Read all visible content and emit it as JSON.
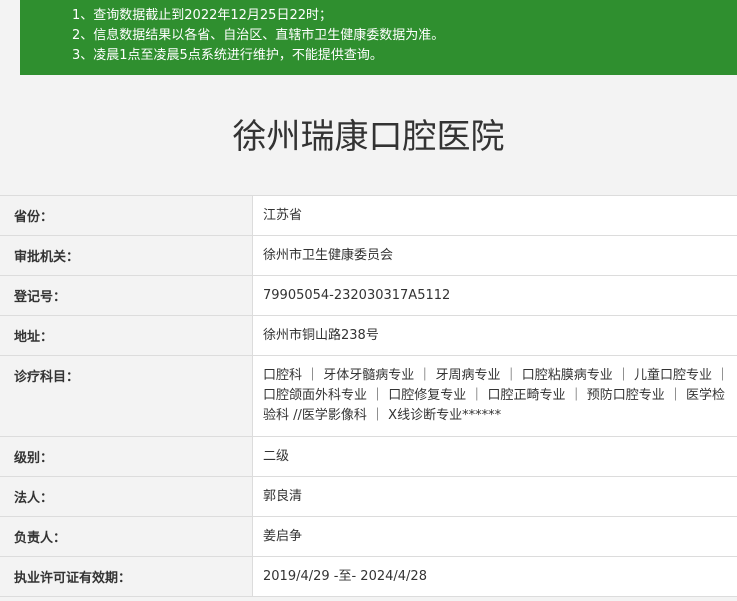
{
  "notice": {
    "lines": [
      "1、查询数据截止到2022年12月25日22时；",
      "2、信息数据结果以各省、自治区、直辖市卫生健康委数据为准。",
      "3、凌晨1点至凌晨5点系统进行维护，不能提供查询。"
    ]
  },
  "hospital": {
    "name": "徐州瑞康口腔医院"
  },
  "rows": [
    {
      "label": "省份：",
      "value": "江苏省"
    },
    {
      "label": "审批机关：",
      "value": "徐州市卫生健康委员会"
    },
    {
      "label": "登记号：",
      "value": "79905054-232030317A5112"
    },
    {
      "label": "地址：",
      "value": "徐州市铜山路238号"
    },
    {
      "label": "诊疗科目：",
      "value": "口腔科 ｜ 牙体牙髓病专业 ｜ 牙周病专业 ｜ 口腔粘膜病专业 ｜ 儿童口腔专业 ｜ 口腔颌面外科专业 ｜ 口腔修复专业 ｜ 口腔正畸专业 ｜ 预防口腔专业 ｜ 医学检验科 //医学影像科 ｜ X线诊断专业******"
    },
    {
      "label": "级别：",
      "value": "二级"
    },
    {
      "label": "法人：",
      "value": "郭良清"
    },
    {
      "label": "负责人：",
      "value": "姜启争"
    },
    {
      "label": "执业许可证有效期：",
      "value": "2019/4/29 -至- 2024/4/28"
    }
  ]
}
